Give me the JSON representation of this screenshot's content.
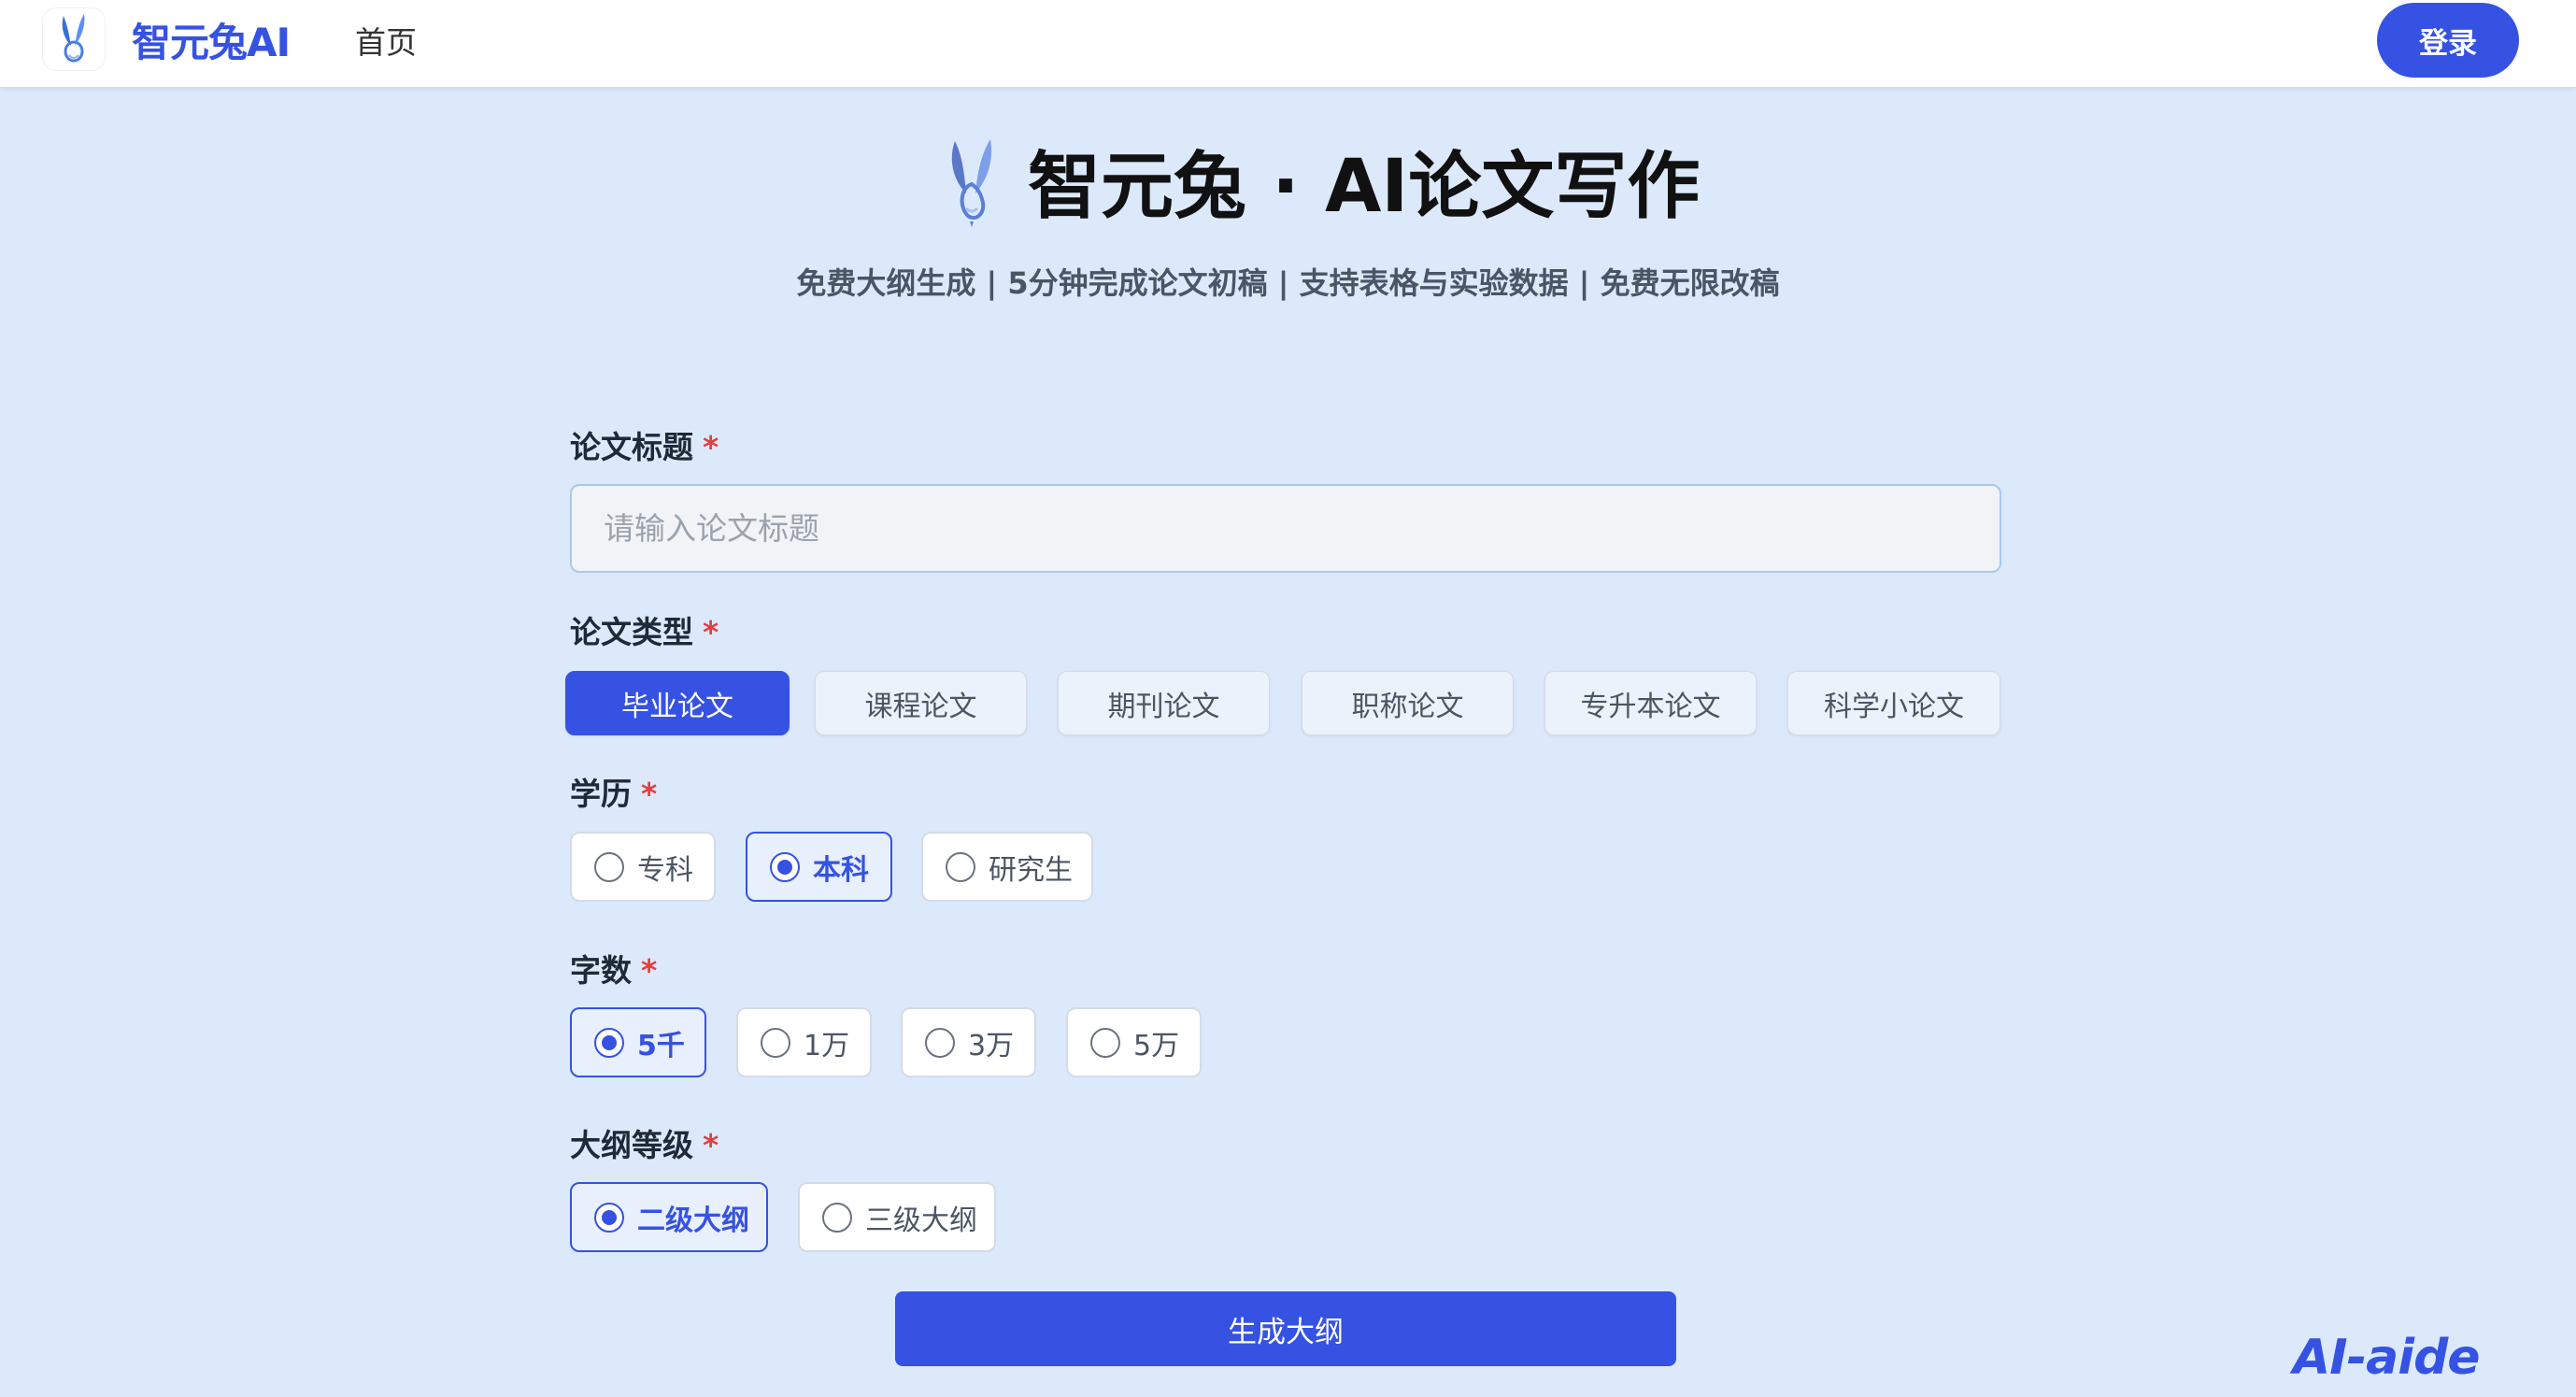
{
  "header": {
    "brand": "智元兔AI",
    "nav_home": "首页",
    "login": "登录"
  },
  "hero": {
    "title": "智元兔 · AI论文写作",
    "subtitle": "免费大纲生成 | 5分钟完成论文初稿 | 支持表格与实验数据 | 免费无限改稿"
  },
  "form": {
    "required_mark": "*",
    "title_label": "论文标题",
    "title_placeholder": "请输入论文标题",
    "title_value": "",
    "type_label": "论文类型",
    "types": [
      "毕业论文",
      "课程论文",
      "期刊论文",
      "职称论文",
      "专升本论文",
      "科学小论文"
    ],
    "type_selected": "毕业论文",
    "degree_label": "学历",
    "degrees": [
      "专科",
      "本科",
      "研究生"
    ],
    "degree_selected": "本科",
    "words_label": "字数",
    "words": [
      "5千",
      "1万",
      "3万",
      "5万"
    ],
    "words_selected": "5千",
    "outline_label": "大纲等级",
    "outlines": [
      "二级大纲",
      "三级大纲"
    ],
    "outline_selected": "二级大纲",
    "generate": "生成大纲"
  },
  "watermark": "AI-aide",
  "colors": {
    "accent": "#3552e3",
    "background": "#dce9fb",
    "required": "#e53e3e"
  }
}
